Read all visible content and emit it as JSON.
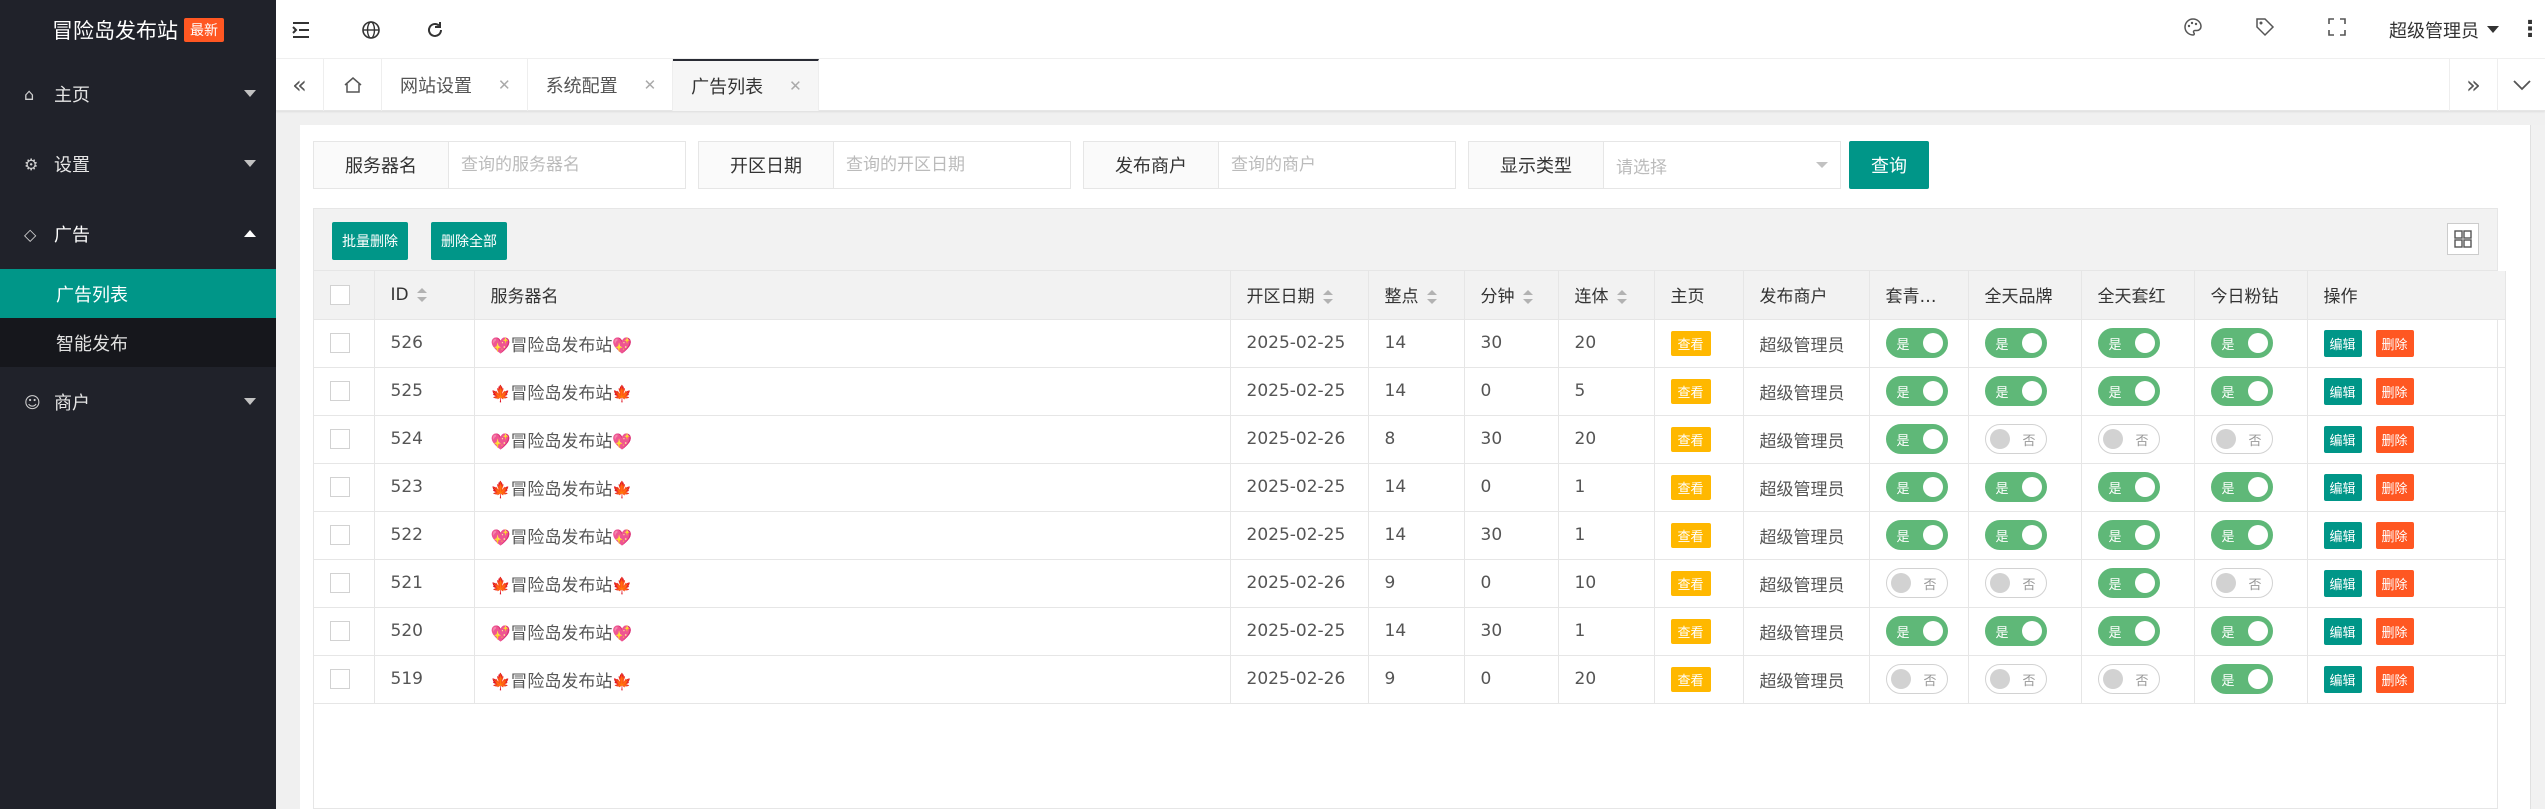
{
  "sidebar": {
    "logo_text": "冒险岛发布站",
    "logo_badge": "最新",
    "items": [
      {
        "label": "主页",
        "icon": "home-icon"
      },
      {
        "label": "设置",
        "icon": "gear-icon"
      },
      {
        "label": "广告",
        "icon": "diamond-icon"
      },
      {
        "label": "商户",
        "icon": "user-icon"
      }
    ],
    "sub_items": [
      {
        "label": "广告列表"
      },
      {
        "label": "智能发布"
      }
    ]
  },
  "header": {
    "user": "超级管理员"
  },
  "tabs": [
    {
      "label": "网站设置"
    },
    {
      "label": "系统配置"
    },
    {
      "label": "广告列表"
    }
  ],
  "filters": [
    {
      "label": "服务器名",
      "placeholder": "查询的服务器名"
    },
    {
      "label": "开区日期",
      "placeholder": "查询的开区日期"
    },
    {
      "label": "发布商户",
      "placeholder": "查询的商户"
    },
    {
      "label": "显示类型",
      "placeholder": "请选择"
    }
  ],
  "query_button": "查询",
  "toolbar": {
    "batch_delete": "批量删除",
    "delete_all": "删除全部"
  },
  "table": {
    "headers": [
      "ID",
      "服务器名",
      "开区日期",
      "整点",
      "分钟",
      "连体",
      "主页",
      "发布商户",
      "套青…",
      "全天品牌",
      "全天套红",
      "今日粉钻",
      "操作"
    ],
    "view_label": "查看",
    "edit_label": "编辑",
    "delete_label": "删除",
    "on_label": "是",
    "off_label": "否",
    "rows": [
      {
        "id": "526",
        "emoji": "💖",
        "name": "冒险岛发布站",
        "date": "2025-02-25",
        "hour": "14",
        "minute": "30",
        "lianti": "20",
        "merchant": "超级管理员",
        "s1": true,
        "s2": true,
        "s3": true,
        "s4": true
      },
      {
        "id": "525",
        "emoji": "🍁",
        "name": "冒险岛发布站",
        "date": "2025-02-25",
        "hour": "14",
        "minute": "0",
        "lianti": "5",
        "merchant": "超级管理员",
        "s1": true,
        "s2": true,
        "s3": true,
        "s4": true
      },
      {
        "id": "524",
        "emoji": "💖",
        "name": "冒险岛发布站",
        "date": "2025-02-26",
        "hour": "8",
        "minute": "30",
        "lianti": "20",
        "merchant": "超级管理员",
        "s1": true,
        "s2": false,
        "s3": false,
        "s4": false
      },
      {
        "id": "523",
        "emoji": "🍁",
        "name": "冒险岛发布站",
        "date": "2025-02-25",
        "hour": "14",
        "minute": "0",
        "lianti": "1",
        "merchant": "超级管理员",
        "s1": true,
        "s2": true,
        "s3": true,
        "s4": true
      },
      {
        "id": "522",
        "emoji": "💖",
        "name": "冒险岛发布站",
        "date": "2025-02-25",
        "hour": "14",
        "minute": "30",
        "lianti": "1",
        "merchant": "超级管理员",
        "s1": true,
        "s2": true,
        "s3": true,
        "s4": true
      },
      {
        "id": "521",
        "emoji": "🍁",
        "name": "冒险岛发布站",
        "date": "2025-02-26",
        "hour": "9",
        "minute": "0",
        "lianti": "10",
        "merchant": "超级管理员",
        "s1": false,
        "s2": false,
        "s3": true,
        "s4": false
      },
      {
        "id": "520",
        "emoji": "💖",
        "name": "冒险岛发布站",
        "date": "2025-02-25",
        "hour": "14",
        "minute": "30",
        "lianti": "1",
        "merchant": "超级管理员",
        "s1": true,
        "s2": true,
        "s3": true,
        "s4": true
      },
      {
        "id": "519",
        "emoji": "🍁",
        "name": "冒险岛发布站",
        "date": "2025-02-26",
        "hour": "9",
        "minute": "0",
        "lianti": "20",
        "merchant": "超级管理员",
        "s1": false,
        "s2": false,
        "s3": false,
        "s4": true
      }
    ]
  },
  "colors": {
    "sidebar_bg": "#20222a",
    "accent": "#009688",
    "danger": "#ff5722",
    "warning": "#ffb800",
    "switch_on": "#5fb878"
  }
}
